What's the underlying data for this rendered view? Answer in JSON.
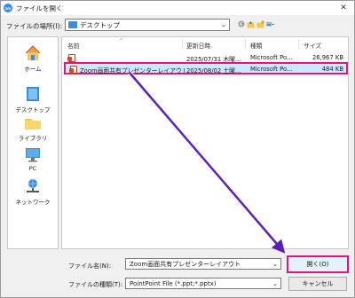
{
  "window": {
    "title": "ファイルを開く",
    "app_icon_text": "zm",
    "close_glyph": "✕"
  },
  "location": {
    "label": "ファイルの場所(I):",
    "value": "デスクトップ"
  },
  "toolbar": {
    "icons": [
      "back-icon",
      "up-folder-icon",
      "new-folder-icon",
      "view-menu-icon"
    ]
  },
  "sidebar": {
    "items": [
      {
        "label": "ホーム",
        "icon": "home-icon"
      },
      {
        "label": "デスクトップ",
        "icon": "desktop-icon"
      },
      {
        "label": "ライブラリ",
        "icon": "library-icon"
      },
      {
        "label": "PC",
        "icon": "pc-icon"
      },
      {
        "label": "ネットワーク",
        "icon": "network-icon"
      }
    ]
  },
  "filelist": {
    "columns": {
      "name": "名前",
      "date": "更新日時",
      "type": "種類",
      "size": "サイズ"
    },
    "rows": [
      {
        "name": "",
        "date": "2025/07/31 木曜...",
        "type": "Microsoft Po...",
        "size": "26,967 KB",
        "selected": false
      },
      {
        "name": "Zoom画面共有プレゼンターレイアウト",
        "date": "2025/08/02 土曜...",
        "type": "Microsoft Po...",
        "size": "484 KB",
        "selected": true
      }
    ]
  },
  "bottom": {
    "filename_label": "ファイル名(N):",
    "filename_value": "Zoom画面共有プレゼンターレイアウト",
    "filetype_label": "ファイルの種類(T):",
    "filetype_value": "PointPoint File (*.ppt;*.pptx)",
    "open_label": "開く(O)",
    "cancel_label": "キャンセル"
  },
  "colors": {
    "highlight": "#e6137c",
    "arrow": "#5b1fbf",
    "selection": "#cce8ff"
  }
}
